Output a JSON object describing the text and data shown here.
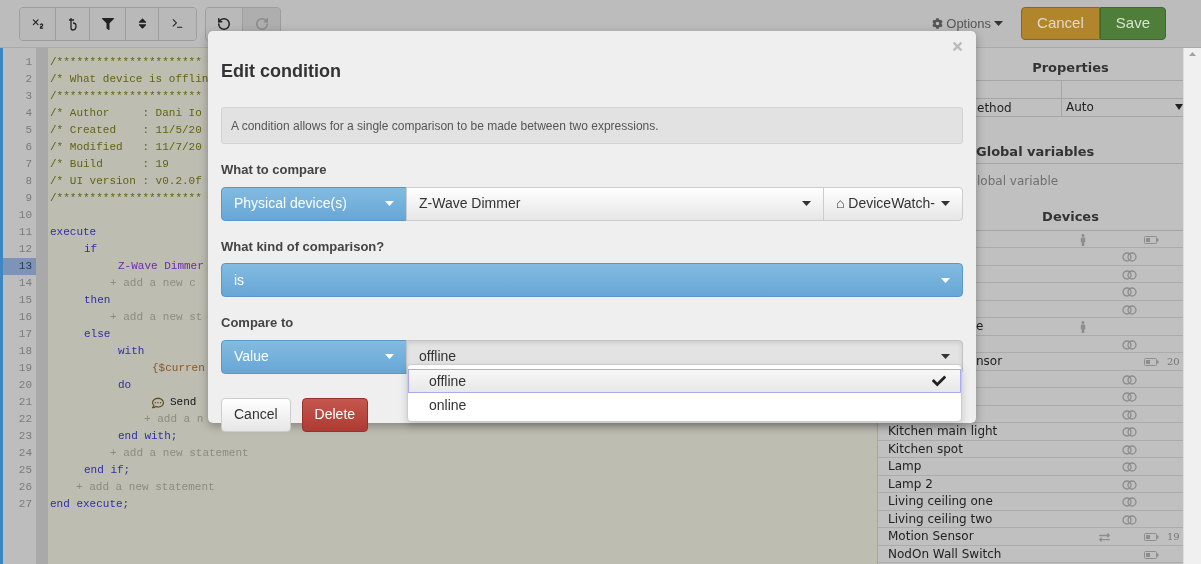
{
  "toolbar": {
    "undo": {
      "disabled": false
    },
    "redo": {
      "disabled": true
    },
    "options": "Options",
    "cancel": "Cancel",
    "save": "Save"
  },
  "editor": {
    "lines": [
      {
        "number": "1",
        "selected": false,
        "segments": [
          {
            "text": "/**********************",
            "kind": "comment"
          }
        ]
      },
      {
        "number": "2",
        "selected": false,
        "segments": [
          {
            "text": "/* What device is offlin",
            "kind": "comment"
          }
        ]
      },
      {
        "number": "3",
        "selected": false,
        "segments": [
          {
            "text": "/**********************",
            "kind": "comment"
          }
        ]
      },
      {
        "number": "4",
        "selected": false,
        "segments": [
          {
            "text": "/* Author     : Dani Io",
            "kind": "comment"
          }
        ]
      },
      {
        "number": "5",
        "selected": false,
        "segments": [
          {
            "text": "/* Created    : 11/5/20",
            "kind": "comment"
          }
        ]
      },
      {
        "number": "6",
        "selected": false,
        "segments": [
          {
            "text": "/* Modified   : 11/7/20",
            "kind": "comment"
          }
        ]
      },
      {
        "number": "7",
        "selected": false,
        "segments": [
          {
            "text": "/* Build      : 19",
            "kind": "comment"
          }
        ]
      },
      {
        "number": "8",
        "selected": false,
        "segments": [
          {
            "text": "/* UI version : v0.2.0f",
            "kind": "comment"
          }
        ]
      },
      {
        "number": "9",
        "selected": false,
        "segments": [
          {
            "text": "/**********************",
            "kind": "comment"
          }
        ]
      },
      {
        "number": "10",
        "selected": false
      },
      {
        "number": "11",
        "selected": false,
        "segments": [
          {
            "text": "execute",
            "kind": "keyword"
          }
        ],
        "children": [
          {
            "number": "12",
            "selected": false,
            "segments": [
              {
                "text": "if",
                "kind": "keyword"
              }
            ],
            "children": [
              {
                "number": "13",
                "selected": true,
                "segments": [
                  {
                    "text": "Z-Wave Dimmer",
                    "kind": "device"
                  }
                ]
              },
              {
                "number": "14",
                "selected": false,
                "segments": [
                  {
                    "text": "+ add a new c",
                    "kind": "hint"
                  }
                ]
              }
            ]
          },
          {
            "number": "15",
            "selected": false,
            "segments": [
              {
                "text": "then",
                "kind": "keyword"
              }
            ],
            "children": [
              {
                "number": "16",
                "selected": false,
                "segments": [
                  {
                    "text": "+ add a new st",
                    "kind": "hint"
                  }
                ]
              }
            ]
          },
          {
            "number": "17",
            "selected": false,
            "segments": [
              {
                "text": "else",
                "kind": "keyword"
              }
            ],
            "children": [
              {
                "number": "18",
                "selected": false,
                "segments": [
                  {
                    "text": "with",
                    "kind": "keyword"
                  }
                ],
                "children": [
                  {
                    "number": "19",
                    "selected": false,
                    "segments": [
                      {
                        "text": "{$curren",
                        "kind": "variable"
                      }
                    ]
                  }
                ]
              },
              {
                "number": "20",
                "selected": false,
                "segments": [
                  {
                    "text": "do",
                    "kind": "keyword"
                  }
                ],
                "children": [
                  {
                    "number": "21",
                    "selected": false,
                    "segments": [
                      {
                        "text": "Send",
                        "kind": "message"
                      }
                    ]
                  },
                  {
                    "number": "22",
                    "selected": false,
                    "segments": [
                      {
                        "text": "+ add a n",
                        "kind": "hint"
                      }
                    ]
                  }
                ]
              },
              {
                "number": "23",
                "selected": false,
                "segments": [
                  {
                    "text": "end with;",
                    "kind": "keyword"
                  }
                ]
              },
              {
                "number": "24",
                "selected": false,
                "segments": [
                  {
                    "text": "+ add a new statement",
                    "kind": "hint"
                  }
                ]
              }
            ]
          },
          {
            "number": "25",
            "selected": false,
            "segments": [
              {
                "text": "end if;",
                "kind": "keyword"
              }
            ]
          },
          {
            "number": "26",
            "selected": false,
            "segments": [
              {
                "text": "+ add a new statement",
                "kind": "hint"
              }
            ]
          }
        ]
      },
      {
        "number": "27",
        "selected": false,
        "segments": [
          {
            "text": "end execute;",
            "kind": "keyword"
          }
        ]
      }
    ]
  },
  "properties": {
    "title": "Properties",
    "rows": [
      {
        "label": "ethod",
        "value": "Auto"
      }
    ]
  },
  "global_variables": {
    "title": "Global variables",
    "empty_text": "lobal variable"
  },
  "devices": {
    "title": "Devices",
    "items": [
      {
        "kind": "switch"
      },
      {
        "kind": "switch"
      },
      {
        "kind": "switch"
      },
      {
        "kind": "switch"
      },
      {
        "kind": "presence",
        "covered": true,
        "name": "e"
      },
      {
        "kind": "switch"
      },
      {
        "kind": "battery",
        "covered": true,
        "name": "nsor",
        "reading": "20"
      },
      {
        "kind": "switch"
      },
      {
        "kind": "switch"
      },
      {
        "kind": "switch"
      },
      {
        "kind": "switch",
        "name": "Kitchen main light"
      },
      {
        "kind": "switch",
        "name": "Kitchen spot"
      },
      {
        "kind": "switch",
        "name": "Lamp"
      },
      {
        "kind": "switch",
        "name": "Lamp 2"
      },
      {
        "kind": "switch",
        "name": "Living ceiling one"
      },
      {
        "kind": "switch",
        "name": "Living ceiling two"
      },
      {
        "kind": "motion",
        "name": "Motion Sensor",
        "reading": "19"
      },
      {
        "kind": "battery",
        "name": "NodOn Wall Switch"
      }
    ]
  },
  "dialog": {
    "title": "Edit condition",
    "info": "A condition allows for a single comparison to be made between two expressions.",
    "sections": [
      {
        "label": "What to compare",
        "controls": [
          {
            "kind": "primary",
            "value": "Physical device(s)"
          },
          {
            "kind": "default",
            "value": "Z-Wave Dimmer"
          },
          {
            "kind": "default",
            "value": "⌂ DeviceWatch-"
          }
        ]
      },
      {
        "label": "What kind of comparison?",
        "controls": [
          {
            "kind": "primary",
            "value": "is"
          }
        ]
      },
      {
        "label": "Compare to",
        "controls": [
          {
            "kind": "primary",
            "value": "Value"
          },
          {
            "kind": "open",
            "value": "offline"
          }
        ]
      }
    ],
    "menu": [
      {
        "label": "offline",
        "selected": true
      },
      {
        "label": "online",
        "selected": false
      }
    ],
    "buttons": [
      {
        "label": "Cancel",
        "kind": "default"
      },
      {
        "label": "Delete",
        "kind": "danger"
      }
    ]
  }
}
